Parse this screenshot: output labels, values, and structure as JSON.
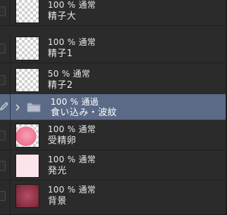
{
  "layers": [
    {
      "meta": "100 % 通常",
      "name": "精子大",
      "thumb": "checker"
    },
    {
      "meta": "100 % 通常",
      "name": "精子1",
      "thumb": "checker"
    },
    {
      "meta": "50 % 通常",
      "name": "精子2",
      "thumb": "checker"
    },
    {
      "meta": "100 % 通過",
      "name": "食い込み・波紋",
      "thumb": "folder",
      "selected": true
    },
    {
      "meta": "100 % 通常",
      "name": "受精卵",
      "thumb": "egg"
    },
    {
      "meta": "100 % 通常",
      "name": "発光",
      "thumb": "glow"
    },
    {
      "meta": "100 % 通常",
      "name": "背景",
      "thumb": "bg"
    }
  ],
  "colors": {
    "panel_bg": "#2b2b2b",
    "selected_bg": "#5b6a87",
    "egg_pink": "#ef7893",
    "glow_pink": "#fbe4ea",
    "bg_red": "#8a2f44"
  },
  "icons": {
    "edit": "pencil-icon",
    "expand": "chevron-right-icon",
    "folder": "folder-icon"
  }
}
